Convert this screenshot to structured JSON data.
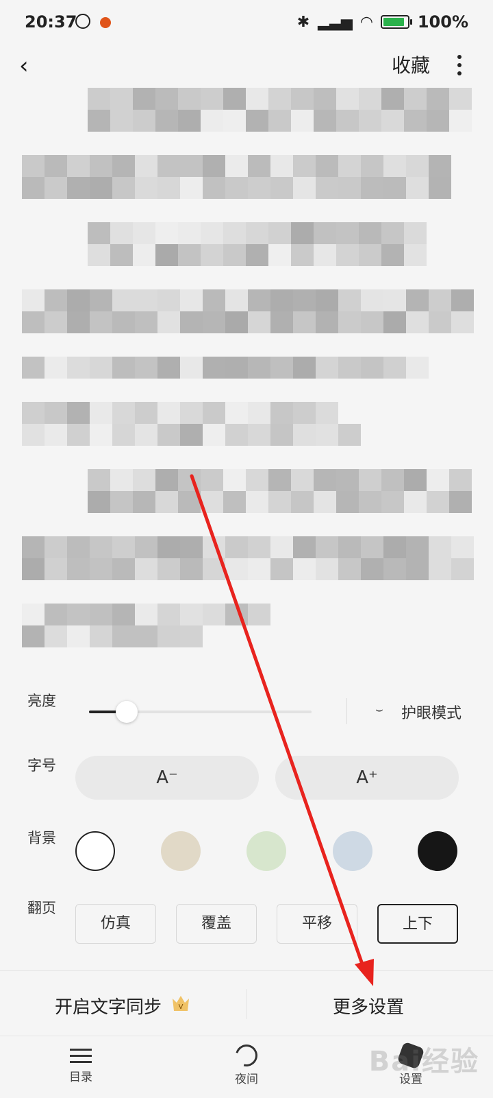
{
  "status_bar": {
    "time": "20:37",
    "battery": "100%",
    "icons": [
      "alarm-icon",
      "notification-icon",
      "bluetooth-icon",
      "hd-signal-icon",
      "wifi-icon",
      "battery-icon"
    ]
  },
  "topbar": {
    "back_icon": "‹",
    "collect": "收藏"
  },
  "settings": {
    "brightness_label": "亮度",
    "brightness_value": 0.17,
    "eye_mode_label": "护眼模式",
    "font_size_label": "字号",
    "font_decrease": "A⁻",
    "font_increase": "A⁺",
    "background_label": "背景",
    "backgrounds": [
      "#ffffff",
      "#e1d9c7",
      "#d7e6cd",
      "#ced9e4",
      "#161616"
    ],
    "selected_background": 0,
    "flip_label": "翻页",
    "flip_modes": [
      "仿真",
      "覆盖",
      "平移",
      "上下"
    ],
    "selected_flip": 3
  },
  "footer": {
    "sync_text": "开启文字同步",
    "more_settings": "更多设置"
  },
  "nav": {
    "items": [
      {
        "label": "目录",
        "icon": "menu-icon"
      },
      {
        "label": "夜间",
        "icon": "moon-icon"
      },
      {
        "label": "设置",
        "icon": "settings-icon"
      }
    ]
  },
  "watermark": "Bai经验",
  "colors": {
    "arrow": "#e8231e",
    "accent_dark": "#222222"
  }
}
